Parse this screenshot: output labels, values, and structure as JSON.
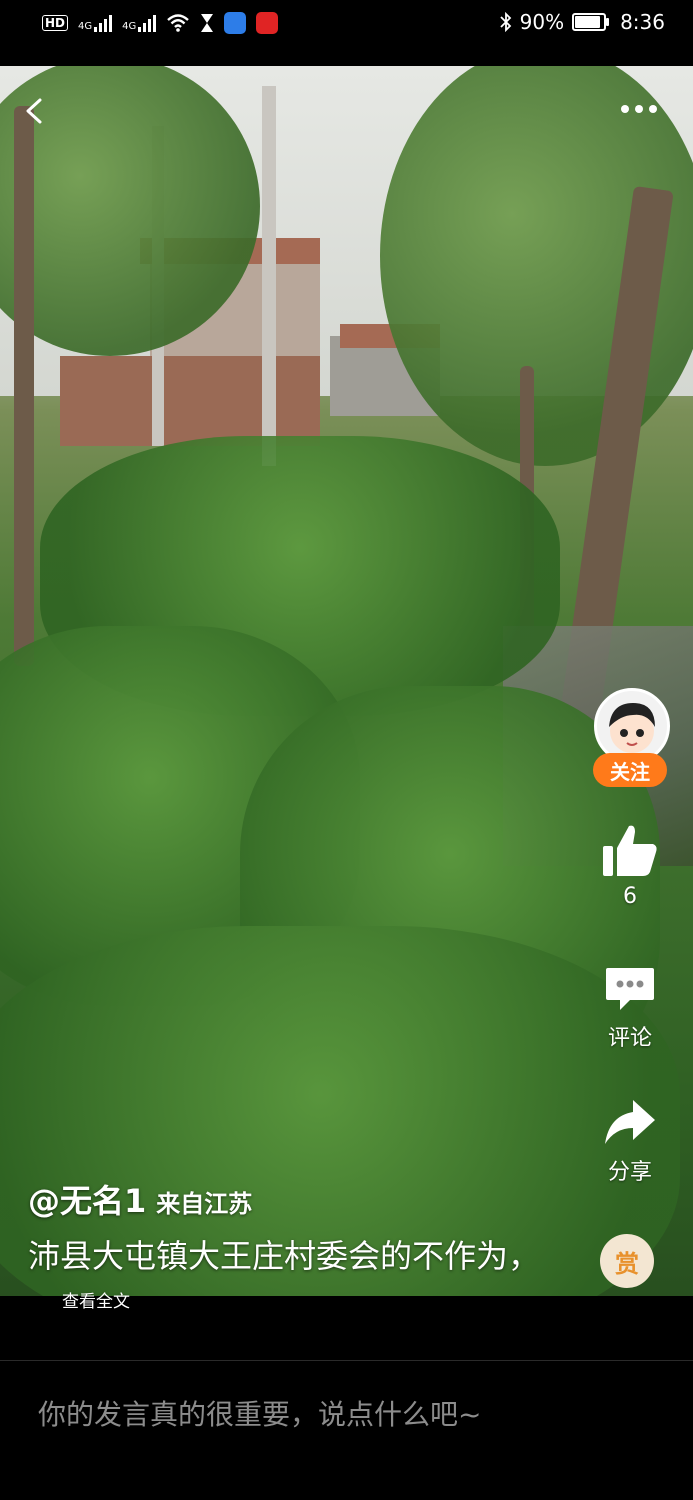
{
  "status_bar": {
    "hd_label": "HD",
    "net1": "4G",
    "net2": "4G",
    "battery_text": "90%",
    "battery_level": 0.9,
    "time": "8:36"
  },
  "author": {
    "handle": "@无名1",
    "location": "来自江苏"
  },
  "post": {
    "caption": "沛县大屯镇大王庄村委会的不作为，",
    "expand_label": "查看全文"
  },
  "actions": {
    "follow_label": "关注",
    "like_count": "6",
    "comment_label": "评论",
    "share_label": "分享",
    "reward_label": "赏"
  },
  "comment_bar": {
    "placeholder": "你的发言真的很重要，说点什么吧~"
  },
  "icons": [
    "back-arrow-icon",
    "more-dots-icon",
    "thumb-up-icon",
    "comment-icon",
    "share-arrow-icon",
    "bluetooth-icon",
    "wifi-icon",
    "battery-icon"
  ],
  "colors": {
    "follow_bg": "#ff7a1a",
    "reward_text": "#e8912c",
    "placeholder": "#8c8c8c"
  }
}
